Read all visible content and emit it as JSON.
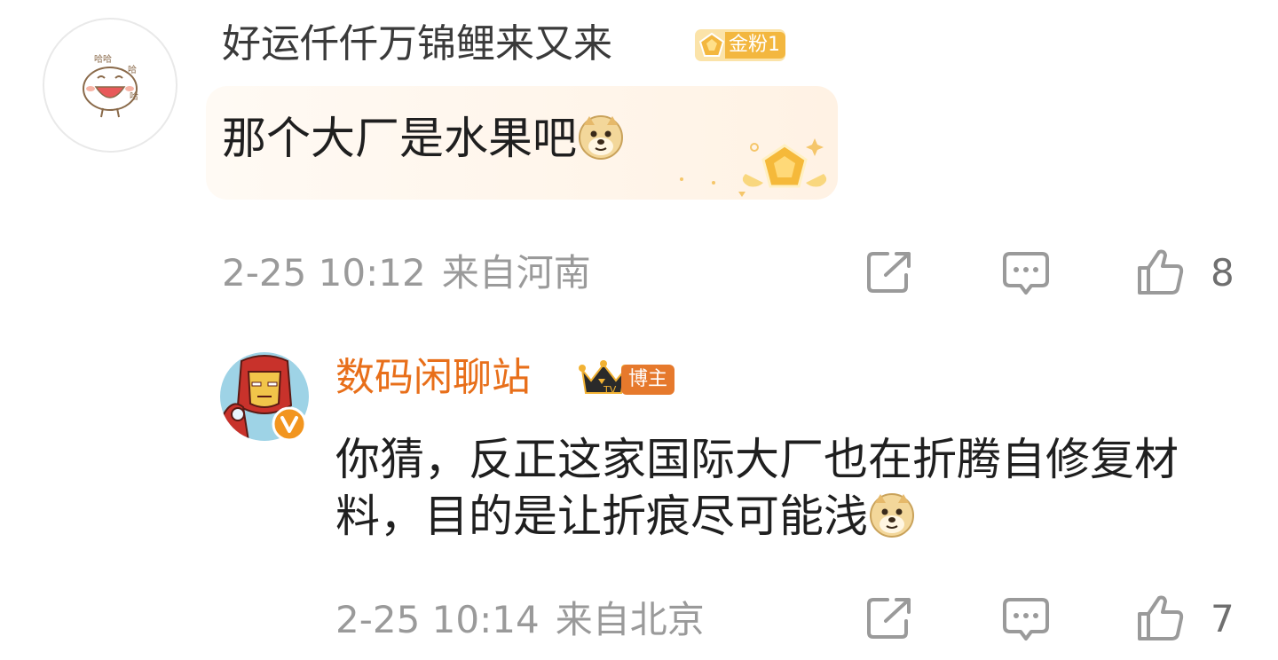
{
  "comments": [
    {
      "user": {
        "name": "好运仟仟万锦鲤来又来",
        "badge": "金粉1",
        "avatar_icon": "laughing-bun-avatar"
      },
      "text": "那个大厂是水果吧",
      "emoji": "doge-emoji",
      "time": "2-25 10:12",
      "location": "来自河南",
      "likes": "8",
      "bubble_decoration": "gold-fan-gem-icon"
    },
    {
      "user": {
        "name": "数码闲聊站",
        "badge": "博主",
        "avatar_icon": "iron-man-avatar",
        "verified_icon": "verified-v-icon"
      },
      "text": "你猜，反正这家国际大厂也在折腾自修复材料，目的是让折痕尽可能浅",
      "emoji": "doge-emoji",
      "time": "2-25 10:14",
      "location": "来自北京",
      "likes": "7"
    }
  ],
  "actions": {
    "share_icon": "share-icon",
    "reply_icon": "comment-icon",
    "like_icon": "thumbs-up-icon"
  },
  "colors": {
    "blogger_name": "#e86f1a",
    "meta_gray": "#9a9a9a",
    "badge_gold": "#f3b73f"
  }
}
